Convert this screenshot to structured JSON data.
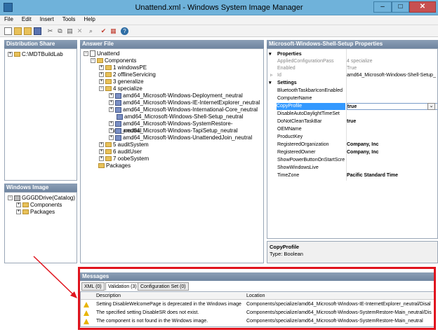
{
  "window": {
    "title": "Unattend.xml - Windows System Image Manager"
  },
  "menu": [
    "File",
    "Edit",
    "Insert",
    "Tools",
    "Help"
  ],
  "panels": {
    "distribution_share": "Distribution Share",
    "windows_image": "Windows Image",
    "answer_file": "Answer File",
    "properties": "Microsoft-Windows-Shell-Setup Properties",
    "messages": "Messages"
  },
  "distribution_tree": [
    "C:\\MDTBuildLab"
  ],
  "image_tree": {
    "root": "GGGDDrive(Catalog)",
    "children": [
      "Components",
      "Packages"
    ]
  },
  "answer_tree": {
    "root": "Unattend",
    "components": "Components",
    "passes": [
      "1 windowsPE",
      "2 offlineServicing",
      "3 generalize",
      "4 specialize"
    ],
    "specialize_items": [
      "amd64_Microsoft-Windows-Deployment_neutral",
      "amd64_Microsoft-Windows-IE-InternetExplorer_neutral",
      "amd64_Microsoft-Windows-International-Core_neutral",
      "amd64_Microsoft-Windows-Shell-Setup_neutral",
      "amd64_Microsoft-Windows-SystemRestore-Main_neutral",
      "amd64_Microsoft-Windows-TapiSetup_neutral",
      "amd64_Microsoft-Windows-UnattendedJoin_neutral"
    ],
    "later_passes": [
      "5 auditSystem",
      "6 auditUser",
      "7 oobeSystem"
    ],
    "packages": "Packages"
  },
  "properties": {
    "section1": "Properties",
    "rows1": [
      {
        "k": "AppliedConfigurationPass",
        "v": "4 specialize"
      },
      {
        "k": "Enabled",
        "v": "True"
      },
      {
        "k": "Id",
        "v": "amd64_Microsoft-Windows-Shell-Setup_"
      }
    ],
    "section2": "Settings",
    "rows2": [
      {
        "k": "BluetoothTaskbarIconEnabled",
        "v": ""
      },
      {
        "k": "ComputerName",
        "v": ""
      },
      {
        "k": "CopyProfile",
        "v": "true"
      },
      {
        "k": "DisableAutoDaylightTimeSet",
        "v": ""
      },
      {
        "k": "DoNotCleanTaskBar",
        "v": "true"
      },
      {
        "k": "OEMName",
        "v": ""
      },
      {
        "k": "ProductKey",
        "v": ""
      },
      {
        "k": "RegisteredOrganization",
        "v": "Company, Inc"
      },
      {
        "k": "RegisteredOwner",
        "v": "Company, Inc"
      },
      {
        "k": "ShowPowerButtonOnStartScre",
        "v": ""
      },
      {
        "k": "ShowWindowsLive",
        "v": ""
      },
      {
        "k": "TimeZone",
        "v": "Pacific Standard Time"
      }
    ],
    "desc_title": "CopyProfile",
    "desc_type": "Type: Boolean"
  },
  "messages": {
    "tabs": [
      "XML (0)",
      "Validation (3)",
      "Configuration Set (0)"
    ],
    "col_description": "Description",
    "col_location": "Location",
    "rows": [
      {
        "d": "Setting DisableWelcomePage is deprecated in the Windows image",
        "l": "Components/specialize/amd64_Microsoft-Windows-IE-InternetExplorer_neutral/Disal"
      },
      {
        "d": "The specified setting DisableSR does not exist.",
        "l": "Components/specialize/amd64_Microsoft-Windows-SystemRestore-Main_neutral/Dis"
      },
      {
        "d": "The component is not found in the Windows image.",
        "l": "Components/specialize/amd64_Microsoft-Windows-SystemRestore-Main_neutral"
      }
    ]
  }
}
